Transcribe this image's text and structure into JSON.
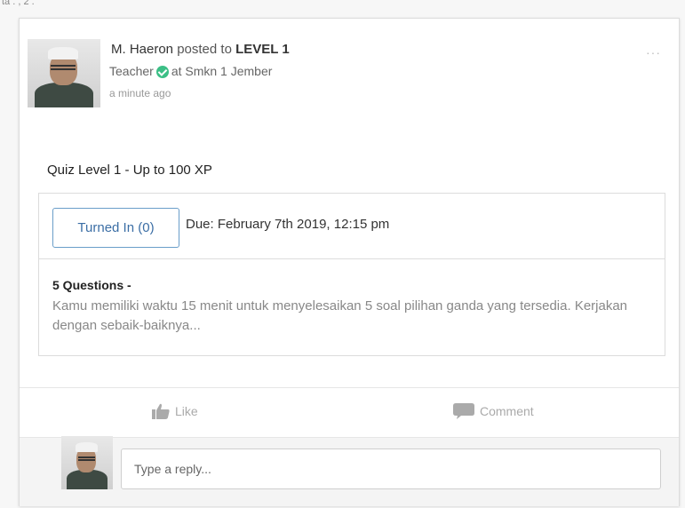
{
  "corner": {
    "text": "ta . , 2 ."
  },
  "post": {
    "author": "M. Haeron",
    "posted_to": "posted to",
    "group": "LEVEL 1",
    "role": "Teacher",
    "school": "at Smkn 1 Jember",
    "time": "a minute ago",
    "menu": "···"
  },
  "quiz": {
    "title": "Quiz Level 1 - Up to 100 XP",
    "turned_in_label": "Turned In (0)",
    "due": "Due: February 7th 2019, 12:15 pm",
    "questions": "5 Questions -",
    "description": "Kamu memiliki waktu 15 menit untuk menyelesaikan 5 soal pilihan ganda yang tersedia. Kerjakan dengan sebaik-baiknya..."
  },
  "actions": {
    "like_label": "Like",
    "comment_label": "Comment"
  },
  "reply": {
    "placeholder": "Type a reply..."
  },
  "colors": {
    "accent": "#3b6ea5",
    "verified": "#3cbf86"
  },
  "icons": [
    "check-circle-icon",
    "thumbs-up-icon",
    "comment-icon",
    "more-dots-icon"
  ]
}
